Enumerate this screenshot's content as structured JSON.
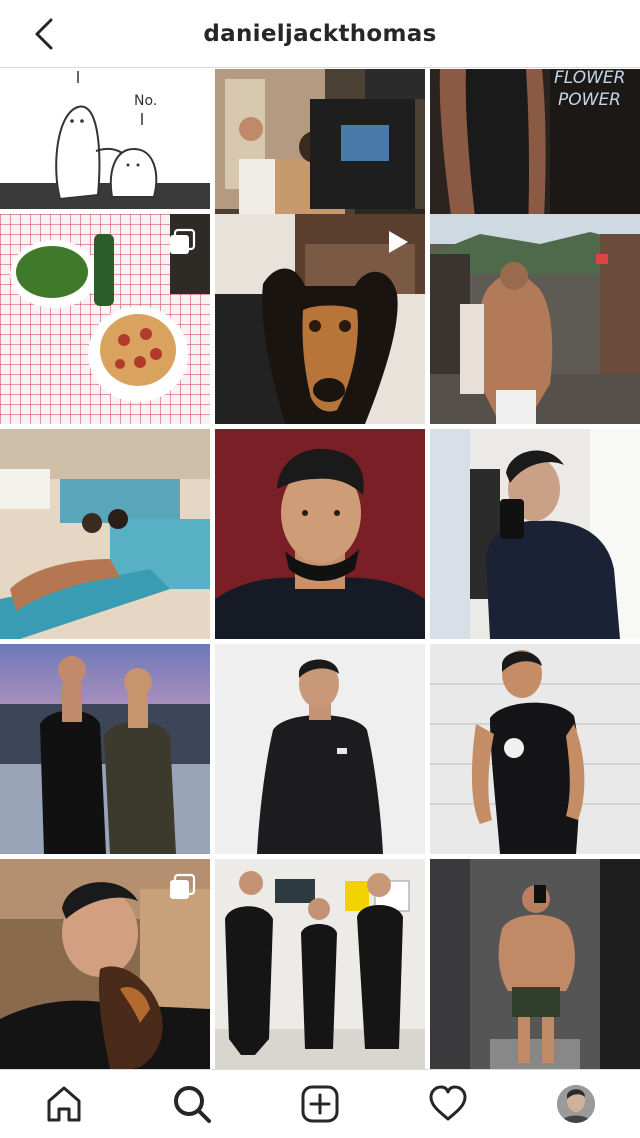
{
  "header": {
    "username": "danieljackthomas",
    "back_icon": "chevron-left-icon"
  },
  "posts": [
    {
      "subject": "cartoon",
      "caption": "No.",
      "media": "image"
    },
    {
      "subject": "film-set",
      "media": "image"
    },
    {
      "subject": "neon-sign",
      "sign_text": "FLOWER\nPOWER",
      "media": "image"
    },
    {
      "subject": "food",
      "media": "carousel"
    },
    {
      "subject": "dog",
      "media": "video"
    },
    {
      "subject": "street",
      "media": "image"
    },
    {
      "subject": "beach",
      "media": "image"
    },
    {
      "subject": "portrait-red",
      "media": "image"
    },
    {
      "subject": "mirror-selfie",
      "media": "image"
    },
    {
      "subject": "sunset-duo",
      "media": "image"
    },
    {
      "subject": "black-sweater",
      "media": "image"
    },
    {
      "subject": "black-tee",
      "media": "image"
    },
    {
      "subject": "dog-kiss",
      "media": "carousel"
    },
    {
      "subject": "police",
      "media": "image"
    },
    {
      "subject": "elevator",
      "media": "image"
    }
  ],
  "tabs": [
    {
      "id": "home",
      "icon": "home-icon"
    },
    {
      "id": "search",
      "icon": "search-icon"
    },
    {
      "id": "new-post",
      "icon": "plus-square-icon"
    },
    {
      "id": "activity",
      "icon": "heart-icon"
    },
    {
      "id": "profile",
      "icon": "avatar"
    }
  ],
  "colors": {
    "text": "#262626",
    "divider": "#dbdbdb",
    "background": "#ffffff"
  }
}
